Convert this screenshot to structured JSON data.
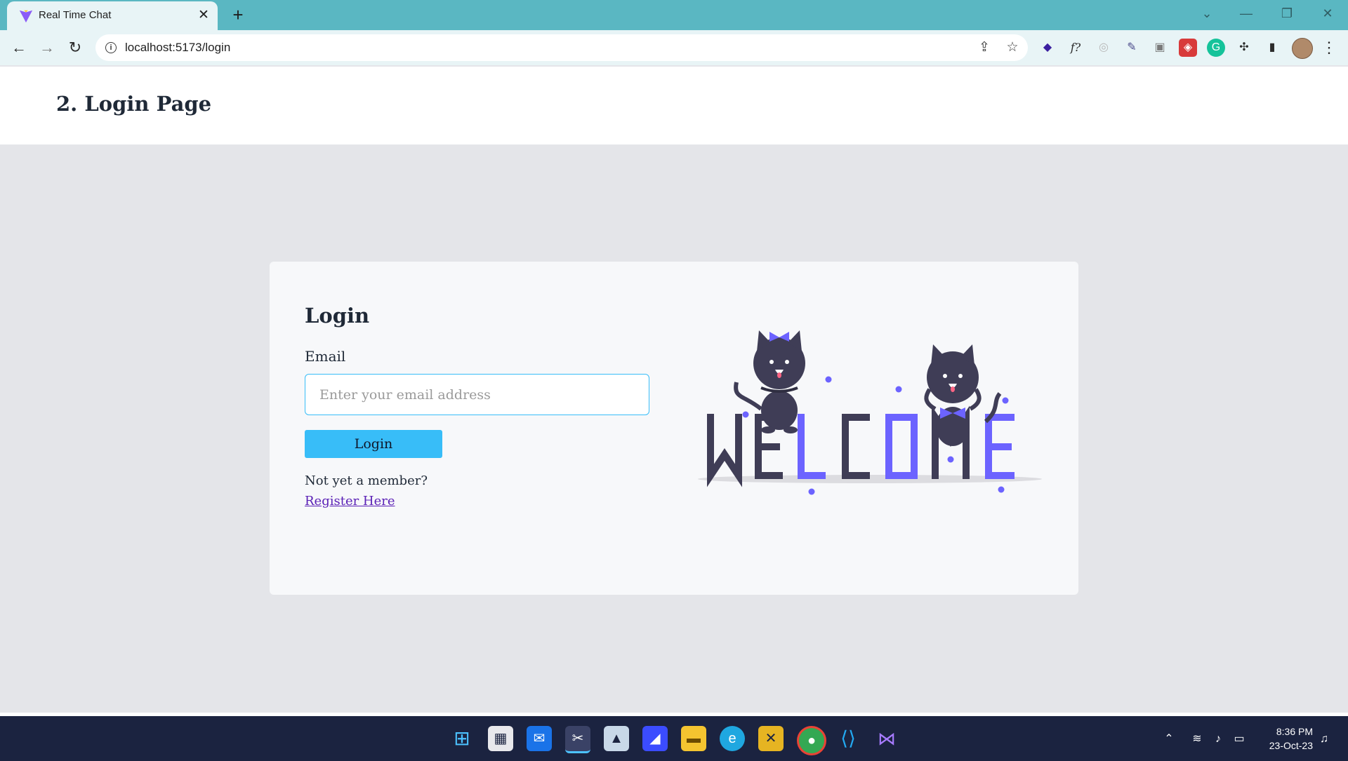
{
  "browser": {
    "tab_title": "Real Time Chat",
    "tab_close": "✕",
    "new_tab": "+",
    "url": "localhost:5173/login",
    "info": "i"
  },
  "page": {
    "heading": "2. Login Page"
  },
  "login": {
    "title": "Login",
    "email_label": "Email",
    "email_placeholder": "Enter your email address",
    "button_label": "Login",
    "not_member_text": "Not yet a member?",
    "register_link": "Register Here"
  },
  "illustration": {
    "letters": [
      "W",
      "E",
      "L",
      "C",
      "O",
      "M",
      "E"
    ],
    "letter_colors": [
      "#3f3d56",
      "#3f3d56",
      "#6c63ff",
      "#3f3d56",
      "#6c63ff",
      "#3f3d56",
      "#6c63ff"
    ],
    "accent": "#6c63ff",
    "dark": "#3f3d56"
  },
  "taskbar": {
    "time": "8:36 PM",
    "date": "23-Oct-23"
  },
  "colors": {
    "chrome_teal": "#5ab7c2",
    "accent_blue": "#38bdf8",
    "link_purple": "#5b21b6",
    "page_bg": "#e4e5e9"
  }
}
